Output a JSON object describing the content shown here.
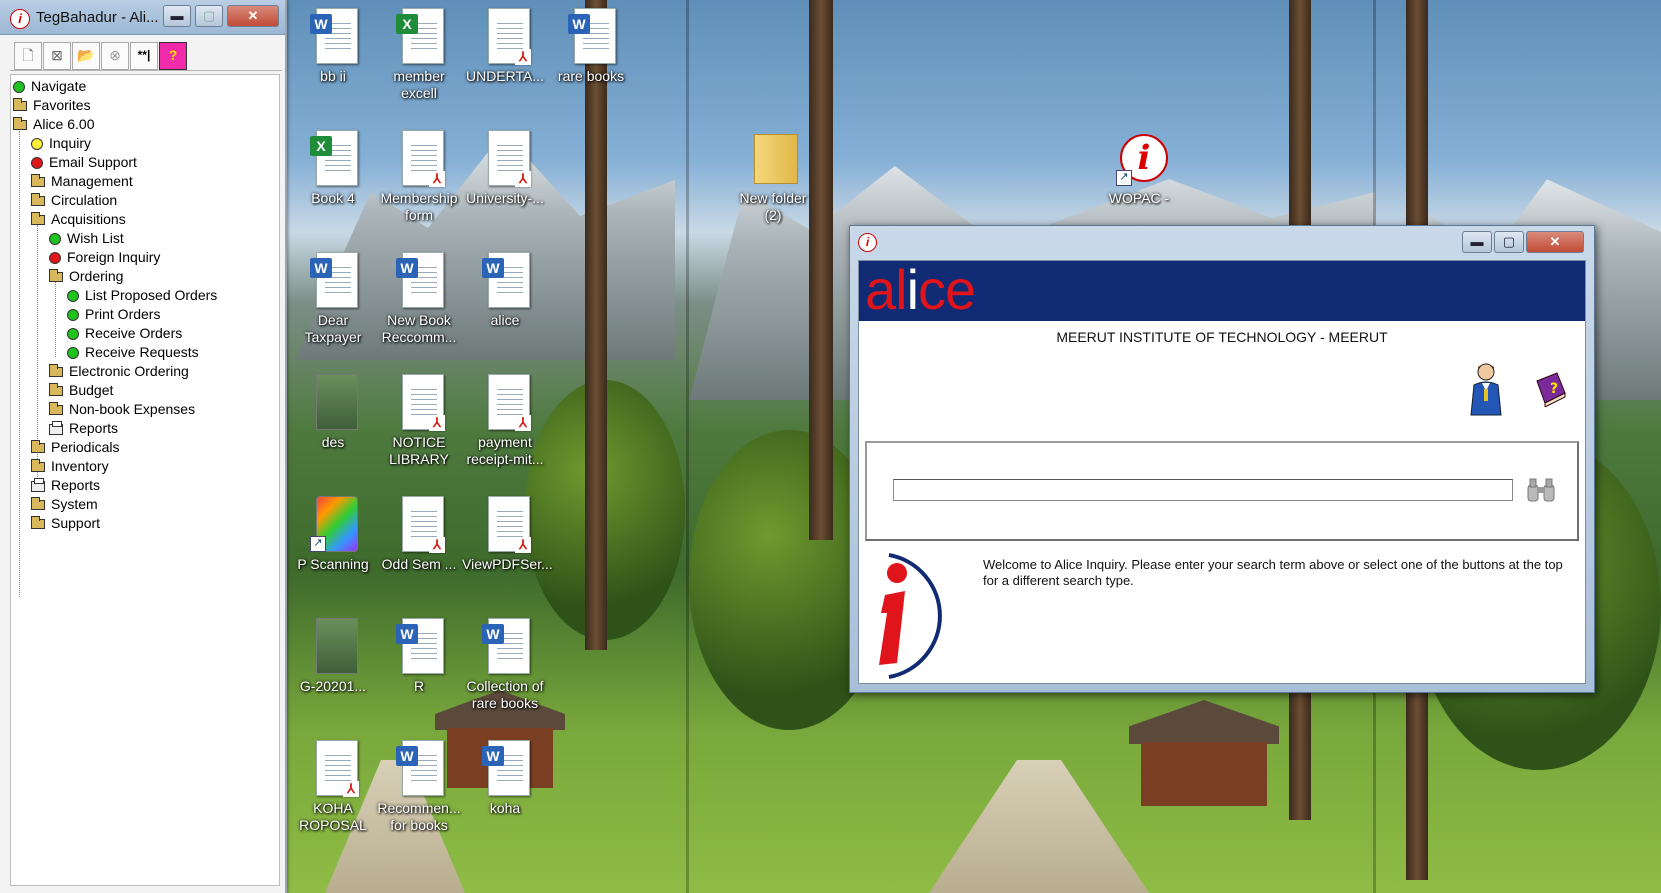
{
  "nav_window": {
    "title": "TegBahadur - Ali...",
    "toolbar": [
      "new-doc-icon",
      "delete-doc-icon",
      "open-folder-icon",
      "stop-icon",
      "keyword-icon",
      "help-icon"
    ],
    "keyword_tool_label": "**|",
    "help_tool_label": "?",
    "tree": [
      {
        "label": "Navigate",
        "icon": "green-dot-icon"
      },
      {
        "label": "Favorites",
        "icon": "folder-icon"
      },
      {
        "label": "Alice 6.00",
        "icon": "folder-icon"
      },
      {
        "label": "Inquiry",
        "icon": "yellow-dot-icon"
      },
      {
        "label": "Email Support",
        "icon": "red-dot-icon"
      },
      {
        "label": "Management",
        "icon": "folder-icon"
      },
      {
        "label": "Circulation",
        "icon": "folder-icon"
      },
      {
        "label": "Acquisitions",
        "icon": "folder-icon"
      },
      {
        "label": "Wish List",
        "icon": "green-dot-icon"
      },
      {
        "label": "Foreign Inquiry",
        "icon": "red-dot-icon"
      },
      {
        "label": "Ordering",
        "icon": "folder-icon"
      },
      {
        "label": "List Proposed Orders",
        "icon": "green-dot-icon"
      },
      {
        "label": "Print Orders",
        "icon": "green-dot-icon"
      },
      {
        "label": "Receive Orders",
        "icon": "green-dot-icon"
      },
      {
        "label": "Receive Requests",
        "icon": "green-dot-icon"
      },
      {
        "label": "Electronic Ordering",
        "icon": "folder-icon"
      },
      {
        "label": "Budget",
        "icon": "folder-icon"
      },
      {
        "label": "Non-book Expenses",
        "icon": "folder-icon"
      },
      {
        "label": "Reports",
        "icon": "printer-icon"
      },
      {
        "label": "Periodicals",
        "icon": "folder-icon"
      },
      {
        "label": "Inventory",
        "icon": "folder-icon"
      },
      {
        "label": "Reports",
        "icon": "printer-icon"
      },
      {
        "label": "System",
        "icon": "folder-icon"
      },
      {
        "label": "Support",
        "icon": "folder-icon"
      }
    ]
  },
  "desktop_icons": [
    {
      "label": "bb ii",
      "type": "word"
    },
    {
      "label": "member excell",
      "type": "excel"
    },
    {
      "label": "UNDERTA...",
      "type": "pdf"
    },
    {
      "label": "rare books",
      "type": "word"
    },
    {
      "label": "Book 4",
      "type": "excel"
    },
    {
      "label": "Membership form",
      "type": "pdf"
    },
    {
      "label": "University-...",
      "type": "pdf"
    },
    {
      "label": "New folder (2)",
      "type": "folder"
    },
    {
      "label": "WOPAC -",
      "type": "shortcut"
    },
    {
      "label": "Dear Taxpayer",
      "type": "word"
    },
    {
      "label": "New Book Reccomm...",
      "type": "word"
    },
    {
      "label": "alice",
      "type": "word"
    },
    {
      "label": "des",
      "type": "image"
    },
    {
      "label": "NOTICE LIBRARY",
      "type": "pdf"
    },
    {
      "label": "payment receipt-mit...",
      "type": "pdf"
    },
    {
      "label": "P Scanning",
      "type": "scanner"
    },
    {
      "label": "Odd Sem ...",
      "type": "pdf"
    },
    {
      "label": "ViewPDFSer...",
      "type": "pdf"
    },
    {
      "label": "G-20201...",
      "type": "image"
    },
    {
      "label": "R",
      "type": "word"
    },
    {
      "label": "Collection of rare books",
      "type": "word"
    },
    {
      "label": "KOHA ROPOSAL",
      "type": "pdf"
    },
    {
      "label": "Recommen... for books",
      "type": "word"
    },
    {
      "label": "koha",
      "type": "word"
    }
  ],
  "alice_window": {
    "logo": {
      "a": "al",
      "i": "i",
      "b": "ce"
    },
    "institute": "MEERUT INSTITUTE OF TECHNOLOGY - MEERUT",
    "search_value": "",
    "welcome": "Welcome to Alice Inquiry.  Please enter your search term above or select one of the buttons at the top for a different search type."
  },
  "colors": {
    "banner": "#102a73",
    "logo_red": "#e0141b",
    "node_green": "#1ec31e",
    "node_red": "#e01818",
    "node_yellow": "#ffee3a"
  }
}
